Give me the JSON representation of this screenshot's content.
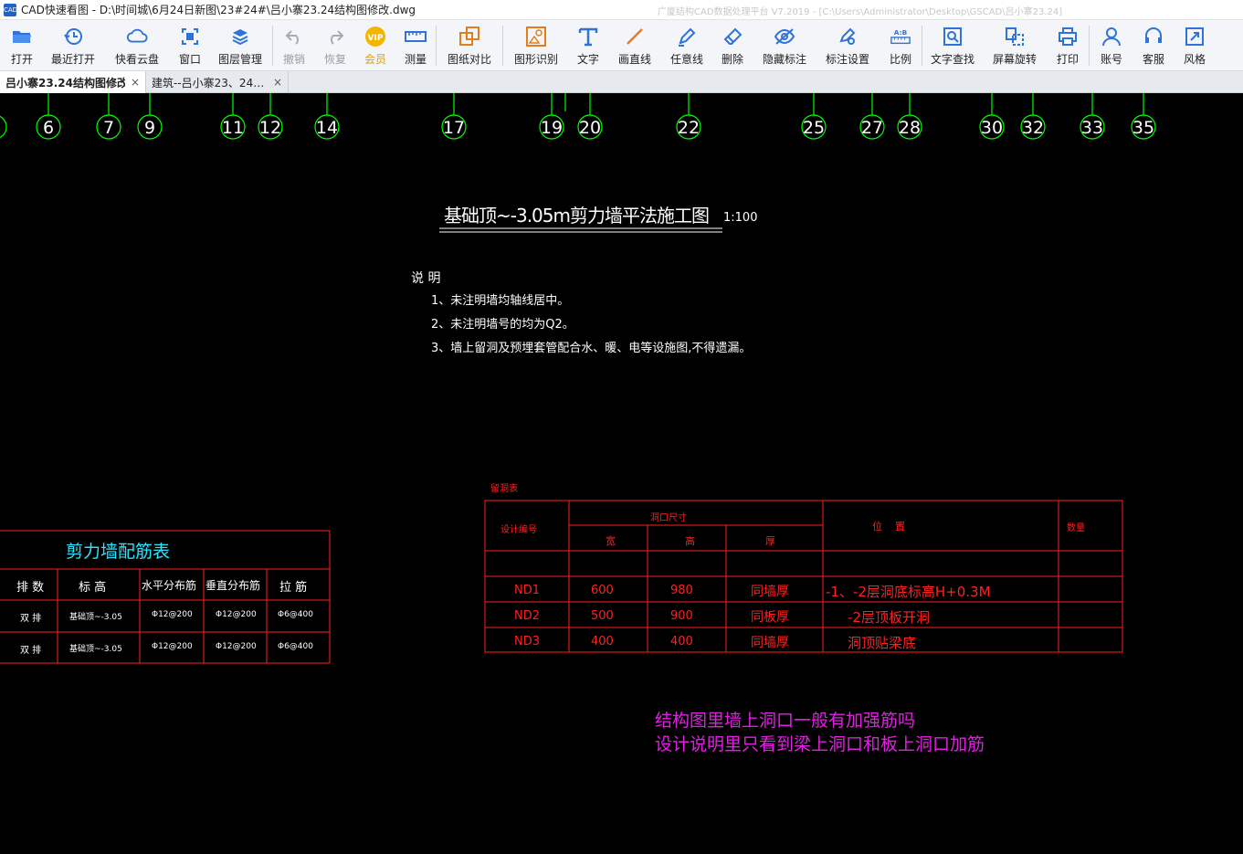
{
  "window": {
    "app_name": "CAD快速看图",
    "file_path": "D:\\时间城\\6月24日新图\\23#24#\\吕小寨23.24结构图修改.dwg",
    "right_text": "广厦结构CAD数据处理平台 V7.2019 - [C:\\Users\\Administrator\\Desktop\\GSCAD\\吕小寨23.24]"
  },
  "toolbar": {
    "open": "打开",
    "recent": "最近打开",
    "cloud": "快看云盘",
    "window": "窗口",
    "layers": "图层管理",
    "undo": "撤销",
    "redo": "恢复",
    "vip": "会员",
    "measure": "测量",
    "compare": "图纸对比",
    "shape_recog": "图形识别",
    "text": "文字",
    "line": "画直线",
    "freeline": "任意线",
    "delete": "删除",
    "hide_mark": "隐藏标注",
    "mark_settings": "标注设置",
    "scale": "比例",
    "text_search": "文字查找",
    "rotate": "屏幕旋转",
    "print": "打印",
    "account": "账号",
    "service": "客服",
    "style": "风格"
  },
  "tabs": [
    {
      "label": "吕小寨23.24结构图修改",
      "close": "×"
    },
    {
      "label": "建筑--吕小寨23、24…",
      "close": "×"
    }
  ],
  "axes": [
    "6",
    "7",
    "9",
    "11",
    "12",
    "14",
    "17",
    "19",
    "20",
    "22",
    "25",
    "27",
    "28",
    "30",
    "32",
    "33",
    "35"
  ],
  "drawing": {
    "title": "基础顶~-3.05m剪力墙平法施工图",
    "scale": "1:100",
    "notes_head": "说 明",
    "notes": [
      "1、未注明墙均轴线居中。",
      "2、未注明墙号的均为Q2。",
      "3、墙上留洞及预埋套管配合水、暖、电等设施图,不得遗漏。"
    ]
  },
  "wall_table": {
    "title": "剪力墙配筋表",
    "headers": [
      "排 数",
      "标 高",
      "水平分布筋",
      "垂直分布筋",
      "拉 筋"
    ],
    "rows": [
      [
        "双 排",
        "基础顶~-3.05",
        "Φ12@200",
        "Φ12@200",
        "Φ6@400"
      ],
      [
        "双 排",
        "基础顶~-3.05",
        "Φ12@200",
        "Φ12@200",
        "Φ6@400"
      ]
    ]
  },
  "hole_table": {
    "title": "留洞表",
    "h_code": "设计编号",
    "h_size": "洞口尺寸",
    "h_w": "宽",
    "h_h": "高",
    "h_t": "厚",
    "h_pos": "位    置",
    "h_qty": "数量",
    "rows": [
      [
        "ND1",
        "600",
        "980",
        "同墙厚",
        "-1、-2层洞底标高H+0.3M"
      ],
      [
        "ND2",
        "500",
        "900",
        "同板厚",
        "-2层顶板开洞"
      ],
      [
        "ND3",
        "400",
        "400",
        "同墙厚",
        "洞顶贴梁底"
      ]
    ]
  },
  "question": {
    "line1": "结构图里墙上洞口一般有加强筋吗",
    "line2": "设计说明里只看到梁上洞口和板上洞口加筋"
  },
  "colors": {
    "axis": "#00ff00",
    "table": "#ff2020",
    "text": "#ffffff",
    "table_title": "#25e5ff",
    "question": "#e31ee3"
  }
}
